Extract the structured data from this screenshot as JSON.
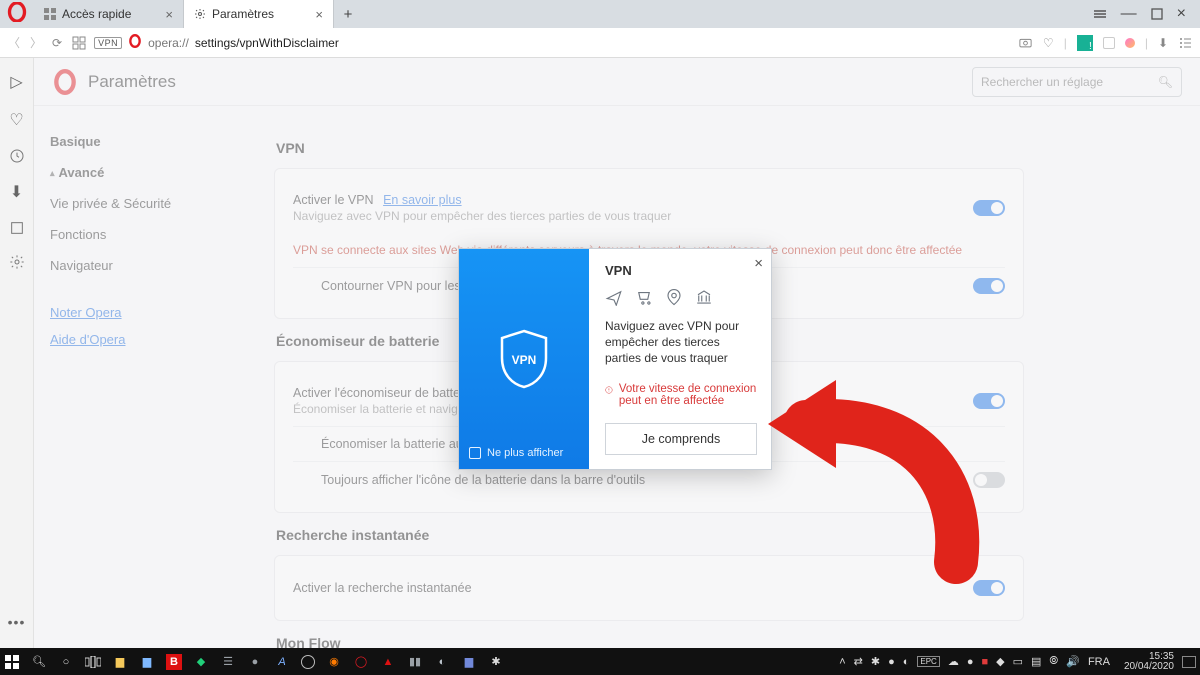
{
  "tabs": [
    {
      "label": "Accès rapide",
      "icon": "speed-dial"
    },
    {
      "label": "Paramètres",
      "icon": "gear"
    }
  ],
  "addressbar": {
    "vpn_chip": "VPN",
    "url_host": "opera://",
    "url_path": "settings/vpnWithDisclaimer"
  },
  "settings_header": {
    "title": "Paramètres",
    "search_placeholder": "Rechercher un réglage"
  },
  "settings_nav": {
    "basic": "Basique",
    "advanced": "Avancé",
    "privacy": "Vie privée & Sécurité",
    "features": "Fonctions",
    "browser": "Navigateur",
    "rate": "Noter Opera",
    "help": "Aide d'Opera"
  },
  "sections": {
    "vpn_title": "VPN",
    "battery_title": "Économiseur de batterie",
    "instant_title": "Recherche instantanée",
    "flow_title": "Mon Flow"
  },
  "vpn_card": {
    "enable_label": "Activer le VPN",
    "learn_more": "En savoir plus",
    "enable_sub": "Naviguez avec VPN pour empêcher des tierces parties de vous traquer",
    "disclaimer": "VPN se connecte aux sites Web via différents serveurs à travers le monde, votre vitesse de connexion peut donc être affectée",
    "bypass_label": "Contourner VPN pour les mo"
  },
  "battery_card": {
    "enable_label": "Activer l'économiseur de batterie",
    "enable_sub": "Économiser la batterie et naviguer j",
    "auto_label": "Économiser la batterie autom",
    "icon_label": "Toujours afficher l'icône de la batterie dans la barre d'outils"
  },
  "instant_card": {
    "enable_label": "Activer la recherche instantanée"
  },
  "modal": {
    "title": "VPN",
    "body": "Naviguez avec VPN pour empêcher des tierces parties de vous traquer",
    "warning": "Votre vitesse de connexion peut en être affectée",
    "ok_button": "Je comprends",
    "dont_show": "Ne plus afficher"
  },
  "taskbar": {
    "lang": "FRA",
    "time": "15:35",
    "date": "20/04/2020"
  }
}
